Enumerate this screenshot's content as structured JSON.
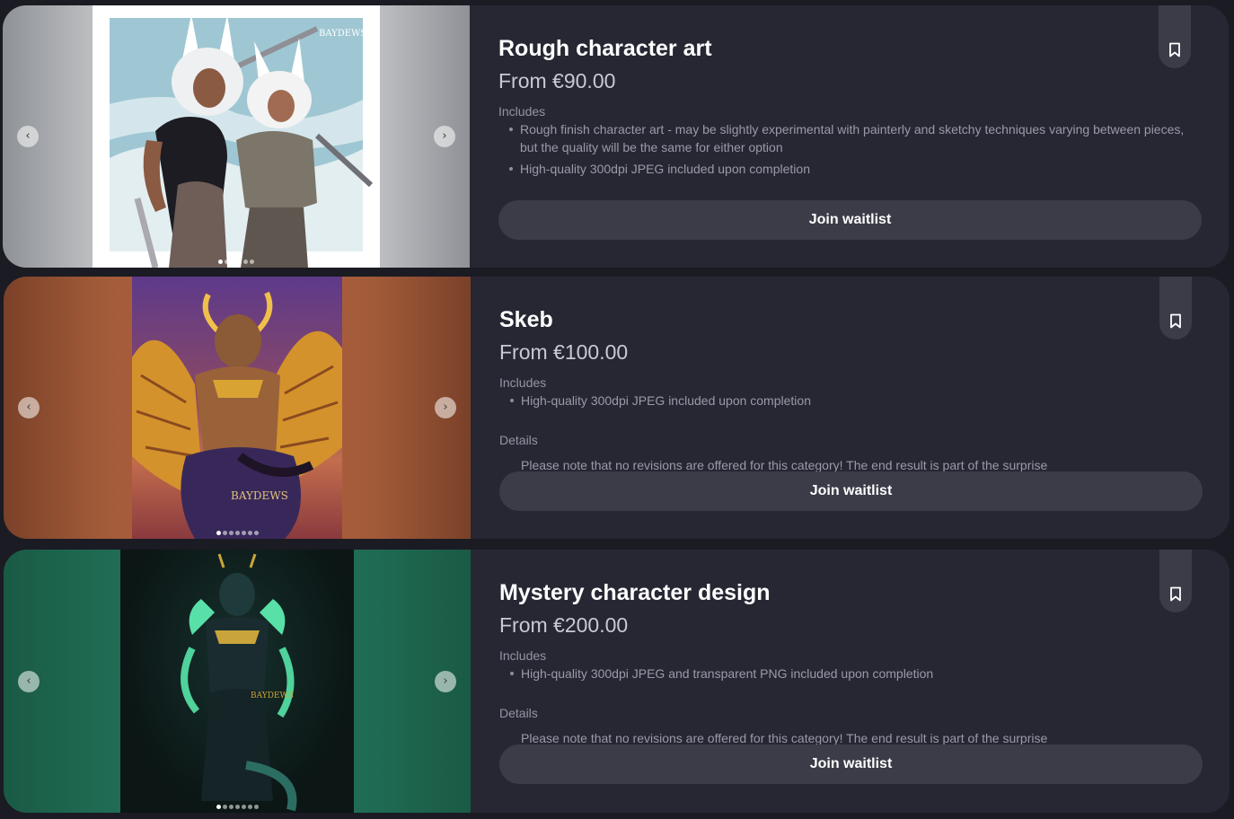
{
  "cards": [
    {
      "title": "Rough character art",
      "price": "From €90.00",
      "includes_label": "Includes",
      "includes": [
        "Rough finish character art - may be slightly experimental with painterly and sketchy techniques varying between pieces, but the quality will be the same for either option",
        "High-quality 300dpi JPEG included upon completion"
      ],
      "button_label": "Join waitlist",
      "image_alt": "Two rabbit-eared warriors with blades against a pale blue sky",
      "watermark": "BAYDEWS",
      "carousel": {
        "count": 6,
        "active": 1
      }
    },
    {
      "title": "Skeb",
      "price": "From €100.00",
      "includes_label": "Includes",
      "includes": [
        "High-quality 300dpi JPEG included upon completion"
      ],
      "details_label": "Details",
      "details_text": "Please note that no revisions are offered for this category! The end result is part of the surprise",
      "button_label": "Join waitlist",
      "image_alt": "Horned demon character with golden wings on a purple-orange background",
      "watermark": "BAYDEWS",
      "carousel": {
        "count": 7,
        "active": 1
      }
    },
    {
      "title": "Mystery character design",
      "price": "From €200.00",
      "includes_label": "Includes",
      "includes": [
        "High-quality 300dpi JPEG and transparent PNG included upon completion"
      ],
      "details_label": "Details",
      "details_text": "Please note that no revisions are offered for this category! The end result is part of the surprise",
      "button_label": "Join waitlist",
      "image_alt": "Dark creature with glowing green accents on a black background",
      "watermark": "BAYDEWS",
      "carousel": {
        "count": 7,
        "active": 1
      }
    }
  ],
  "icons": {
    "prev": "chevron-left-icon",
    "next": "chevron-right-icon",
    "bookmark": "bookmark-icon"
  },
  "colors": {
    "page_bg": "#1b1b24",
    "card_bg": "#262733",
    "button_bg": "#3b3c48",
    "muted_text": "#9a9ba8"
  }
}
